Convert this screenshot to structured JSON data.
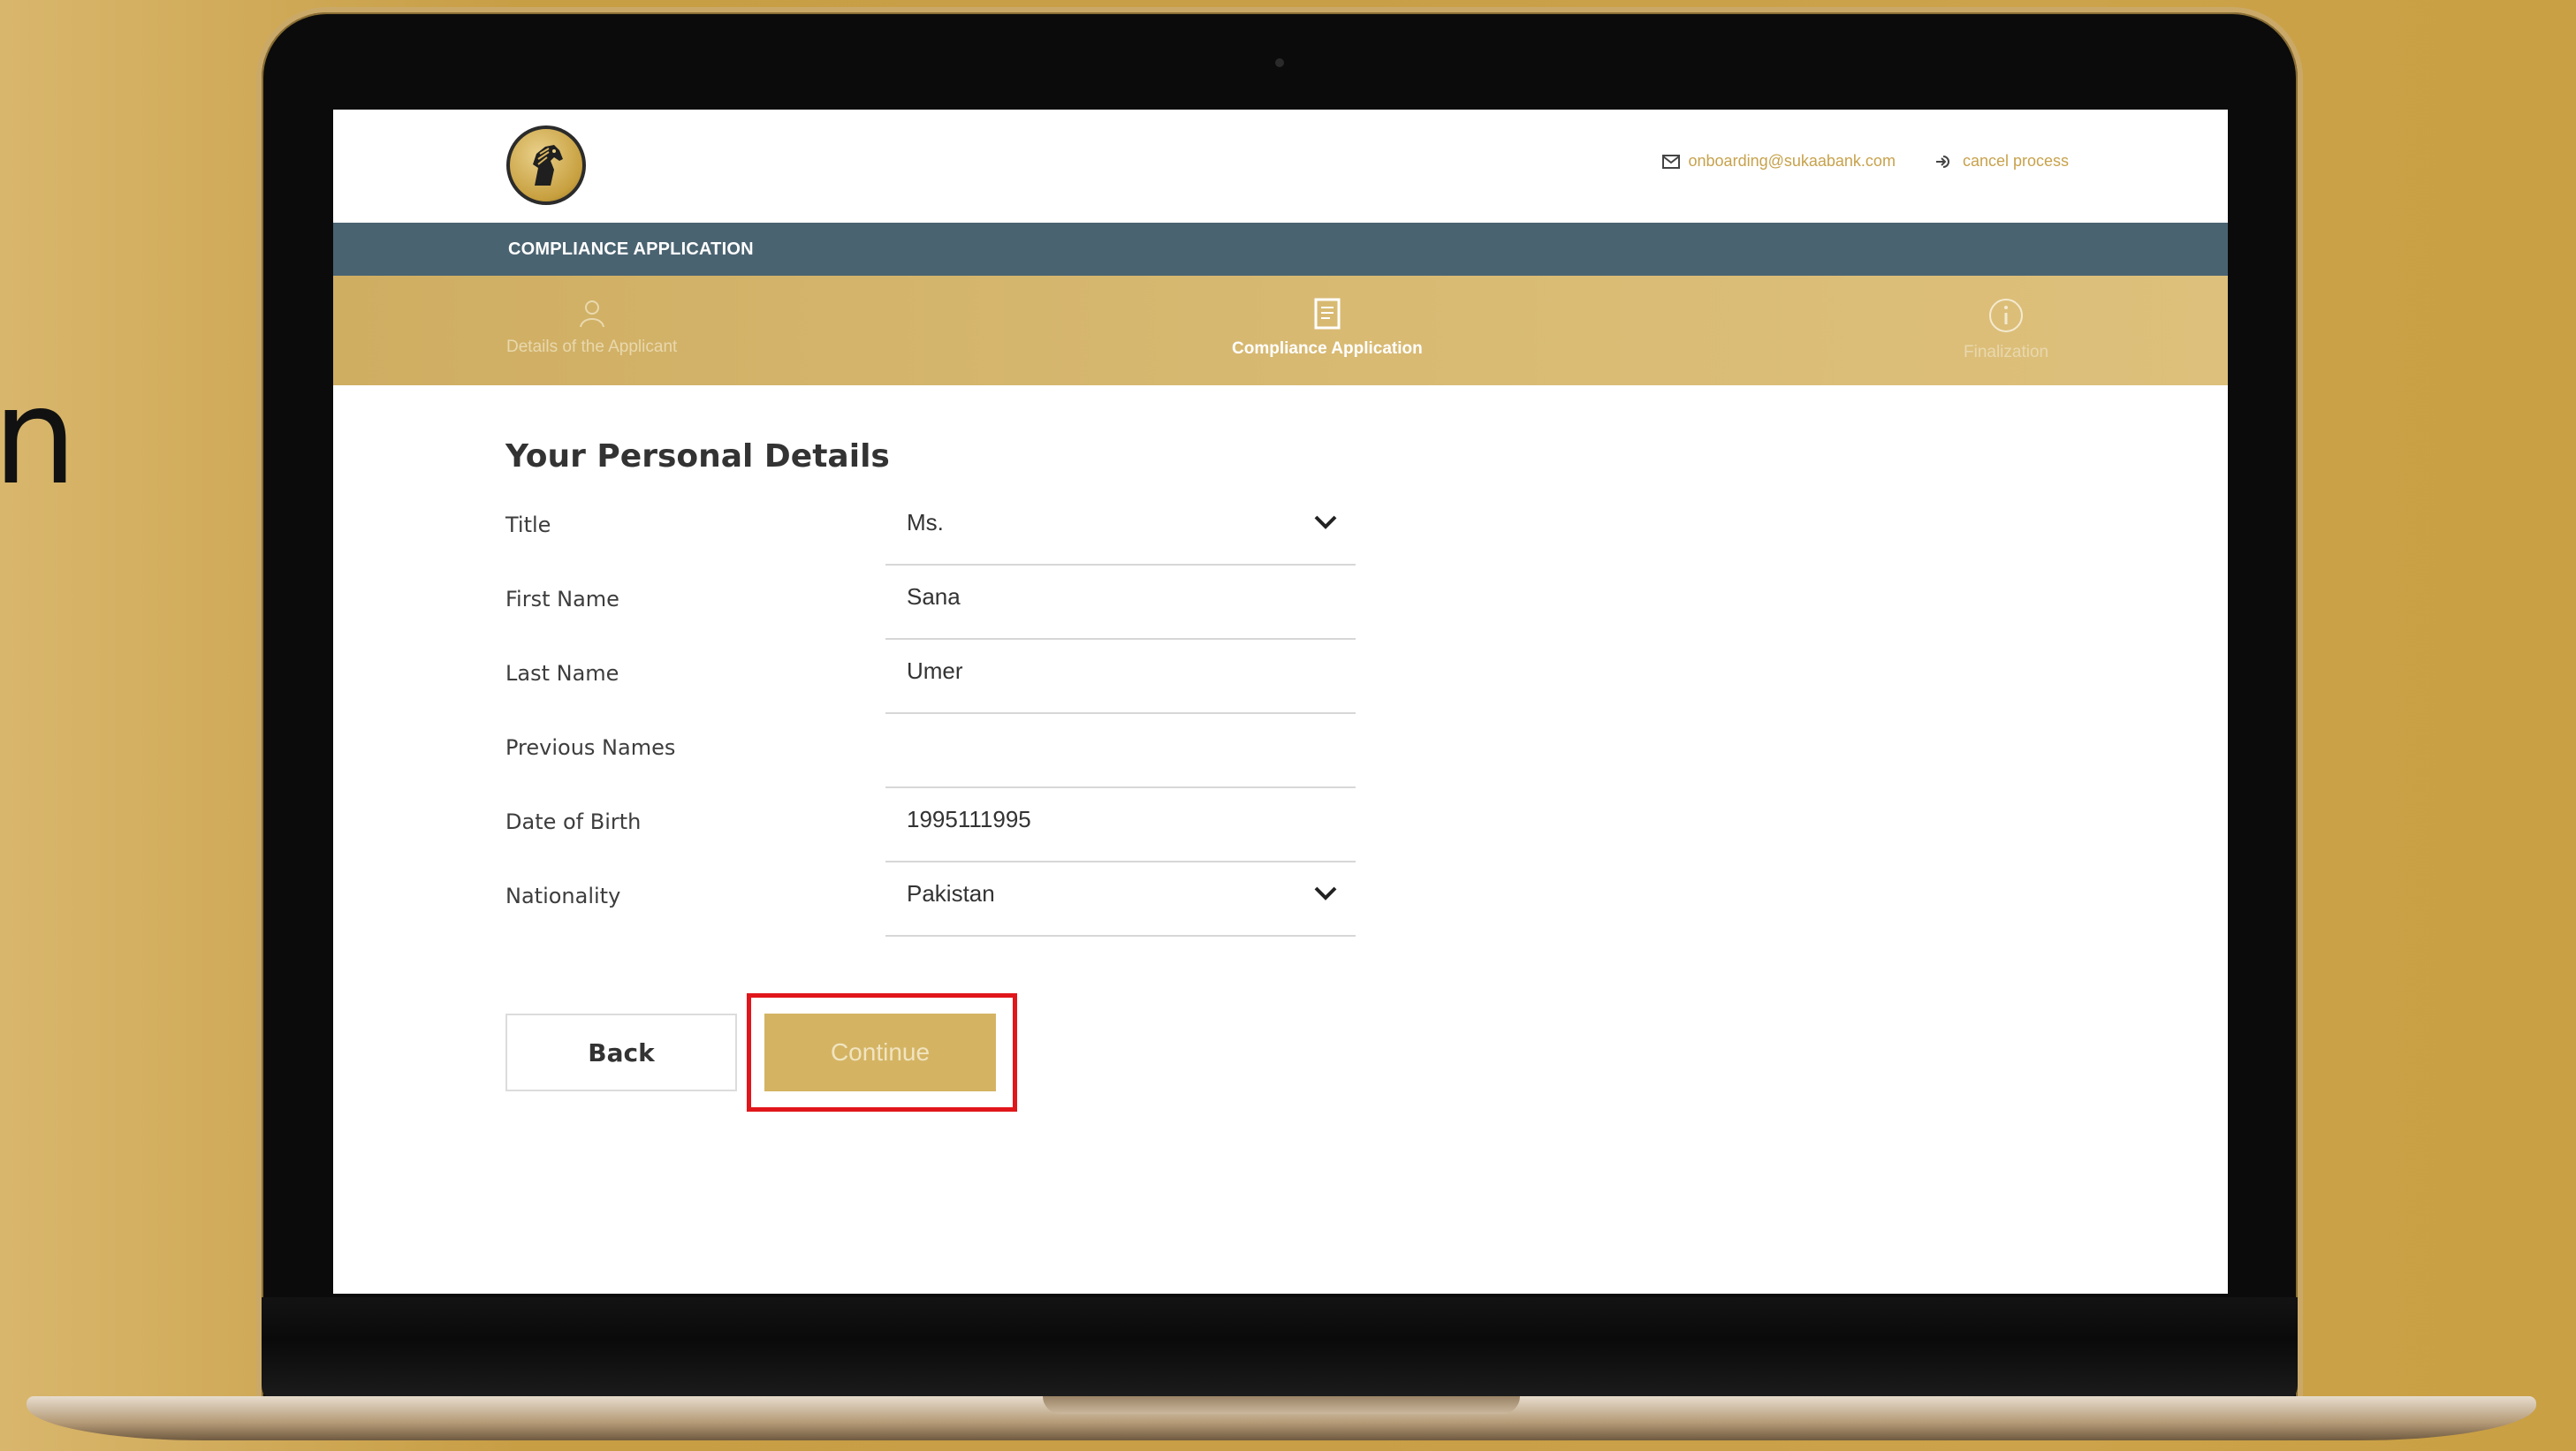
{
  "side_text": "n",
  "header": {
    "email": "onboarding@sukaabank.com",
    "cancel": "cancel process"
  },
  "app_title": "COMPLIANCE APPLICATION",
  "steps": [
    {
      "label": "Details of the Applicant",
      "icon": "user-icon",
      "active": false
    },
    {
      "label": "Compliance Application",
      "icon": "document-icon",
      "active": true
    },
    {
      "label": "Finalization",
      "icon": "info-icon",
      "active": false
    }
  ],
  "form": {
    "title": "Your Personal Details",
    "fields": [
      {
        "label": "Title",
        "value": "Ms.",
        "type": "select"
      },
      {
        "label": "First Name",
        "value": "Sana",
        "type": "text"
      },
      {
        "label": "Last Name",
        "value": "Umer",
        "type": "text"
      },
      {
        "label": "Previous Names",
        "value": "",
        "type": "text"
      },
      {
        "label": "Date of Birth",
        "value": "1995111995",
        "type": "text"
      },
      {
        "label": "Nationality",
        "value": "Pakistan",
        "type": "select"
      }
    ]
  },
  "buttons": {
    "back": "Back",
    "continue": "Continue"
  },
  "colors": {
    "gold": "#d4b463",
    "appbar": "#4a6371",
    "highlight": "#e0161b"
  }
}
